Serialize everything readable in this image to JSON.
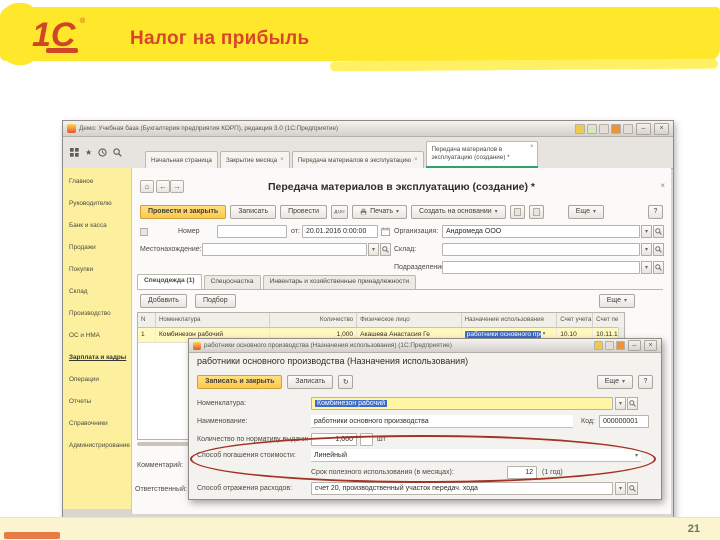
{
  "slide": {
    "logo_text": "1С",
    "logo_reg": "®",
    "title": "Налог на прибыль",
    "page_number": "21"
  },
  "glyphs": {
    "dropdown": "▾",
    "close": "×",
    "minimize": "–",
    "back": "←",
    "forward": "→",
    "home": "⌂",
    "refresh": "↻",
    "star": "★"
  },
  "app_window": {
    "titlebar_title": "Демо: Учебная база (Бухгалтерия предприятия КОРП), редакция 3.0 (1С:Предприятие)",
    "nav_tabs": [
      "Начальная страница",
      "Закрытие месяца",
      "Передача материалов в эксплуатацию",
      "Передача материалов в эксплуатацию (создание) *"
    ],
    "sidebar_items": [
      "Главное",
      "Руководителю",
      "Банк и касса",
      "Продажи",
      "Покупки",
      "Склад",
      "Производство",
      "ОС и НМА",
      "Зарплата и кадры",
      "Операции",
      "Отчеты",
      "Справочники",
      "Администрирование"
    ]
  },
  "document_form": {
    "title": "Передача материалов в эксплуатацию (создание) *",
    "toolbar": {
      "post_and_close": "Провести и закрыть",
      "save": "Записать",
      "post": "Провести",
      "dt_kt": "Дт,Кт",
      "print": "Печать",
      "create_based_on": "Создать на основании",
      "more": "Еще",
      "help": "?"
    },
    "fields": {
      "number_label": "Номер",
      "number_value": "",
      "date_label": "от:",
      "date_value": "20.01.2016 0:00:00",
      "org_label": "Организация:",
      "org_value": "Андромеда ООО",
      "location_label": "Местонахождение:",
      "location_value": "",
      "warehouse_label": "Склад:",
      "warehouse_value": "",
      "department_label": "Подразделение:",
      "department_value": ""
    },
    "section_tabs": [
      "Спецодежда (1)",
      "Спецоснастка",
      "Инвентарь и хозяйственные принадлежности"
    ],
    "commands": {
      "add": "Добавить",
      "pick": "Подбор",
      "more": "Еще"
    },
    "table": {
      "headers": [
        "N",
        "Номенклатура",
        "Количество",
        "Физическое лицо",
        "Назначение использования",
        "Счет учета",
        "Счет пе"
      ],
      "rows": [
        {
          "n": "1",
          "nomenclature": "Комбинезон рабочий",
          "quantity": "1,000",
          "person": "Акашева Анастасия Ге",
          "purpose": "работники основного прои",
          "account": "10.10",
          "transfer_account": "10.11.1"
        }
      ]
    },
    "comment_label": "Комментарий:",
    "responsible_label": "Ответственный:"
  },
  "dialog": {
    "titlebar_title": "работники основного производства (Назначения использования) (1С:Предприятие)",
    "heading": "работники основного производства (Назначения использования)",
    "toolbar": {
      "save_and_close": "Записать и закрыть",
      "save": "Записать",
      "more": "Еще",
      "help": "?"
    },
    "fields": {
      "nomenclature_label": "Номенклатура:",
      "nomenclature_value": "Комбинезон рабочий",
      "name_label": "Наименование:",
      "name_value": "работники основного производства",
      "code_label": "Код:",
      "code_value": "000000001",
      "quantity_label": "Количество по нормативу выдачи:",
      "quantity_value": "1,000",
      "unit": "шт",
      "writeoff_method_label": "Способ погашения стоимости:",
      "writeoff_method_value": "Линейный",
      "useful_life_label": "Срок полезного использования (в месяцах):",
      "useful_life_value": "12",
      "useful_life_note": "(1 год)",
      "expense_method_label": "Способ отражения расходов:",
      "expense_method_value": "счет 20, производственный участок передач. хода"
    }
  }
}
